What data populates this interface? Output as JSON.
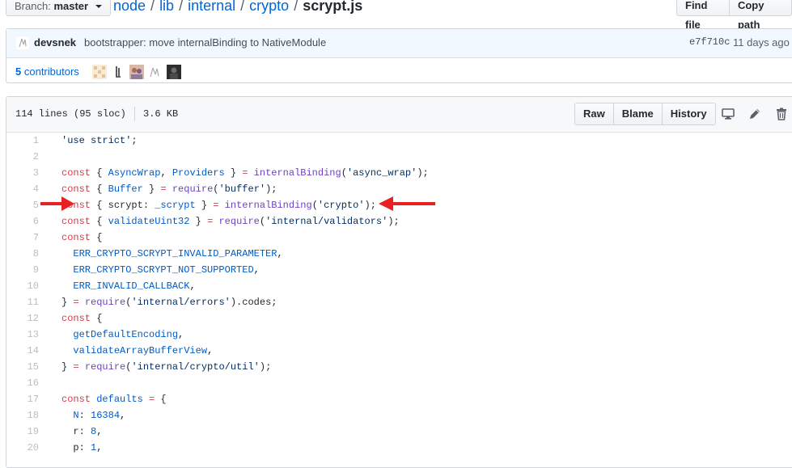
{
  "branch": {
    "label": "Branch:",
    "value": "master"
  },
  "breadcrumb": {
    "parts": [
      "node",
      "lib",
      "internal",
      "crypto"
    ],
    "separator": "/",
    "file": "scrypt.js"
  },
  "top_buttons": {
    "find_file": "Find file",
    "copy_path": "Copy path"
  },
  "commit": {
    "author": "devsnek",
    "message": "bootstrapper: move internalBinding to NativeModule",
    "sha": "e7f710c",
    "date": "11 days ago"
  },
  "contributors": {
    "count": "5",
    "label": "contributors"
  },
  "file": {
    "lines_info": "114 lines (95 sloc)",
    "size": "3.6 KB",
    "buttons": {
      "raw": "Raw",
      "blame": "Blame",
      "history": "History"
    },
    "icons": [
      "desktop-icon",
      "pencil-icon",
      "trash-icon"
    ]
  },
  "code_lines": [
    {
      "n": "1",
      "segs": [
        [
          "s",
          "'use strict'"
        ],
        [
          "",
          ";"
        ]
      ]
    },
    {
      "n": "2",
      "segs": []
    },
    {
      "n": "3",
      "segs": [
        [
          "k",
          "const"
        ],
        [
          "",
          " { "
        ],
        [
          "c",
          "AsyncWrap"
        ],
        [
          "",
          ", "
        ],
        [
          "c",
          "Providers"
        ],
        [
          "",
          " } "
        ],
        [
          "k",
          "="
        ],
        [
          "",
          " "
        ],
        [
          "f",
          "internalBinding"
        ],
        [
          "",
          "("
        ],
        [
          "s",
          "'async_wrap'"
        ],
        [
          "",
          ");"
        ]
      ]
    },
    {
      "n": "4",
      "segs": [
        [
          "k",
          "const"
        ],
        [
          "",
          " { "
        ],
        [
          "c",
          "Buffer"
        ],
        [
          "",
          " } "
        ],
        [
          "k",
          "="
        ],
        [
          "",
          " "
        ],
        [
          "f",
          "require"
        ],
        [
          "",
          "("
        ],
        [
          "s",
          "'buffer'"
        ],
        [
          "",
          ");"
        ]
      ]
    },
    {
      "n": "5",
      "segs": [
        [
          "k",
          "const"
        ],
        [
          "",
          " { scrypt: "
        ],
        [
          "c",
          "_scrypt"
        ],
        [
          "",
          " } "
        ],
        [
          "k",
          "="
        ],
        [
          "",
          " "
        ],
        [
          "f",
          "internalBinding"
        ],
        [
          "",
          "("
        ],
        [
          "s",
          "'crypto'"
        ],
        [
          "",
          ");"
        ]
      ]
    },
    {
      "n": "6",
      "segs": [
        [
          "k",
          "const"
        ],
        [
          "",
          " { "
        ],
        [
          "c",
          "validateUint32"
        ],
        [
          "",
          " } "
        ],
        [
          "k",
          "="
        ],
        [
          "",
          " "
        ],
        [
          "f",
          "require"
        ],
        [
          "",
          "("
        ],
        [
          "s",
          "'internal/validators'"
        ],
        [
          "",
          ");"
        ]
      ]
    },
    {
      "n": "7",
      "segs": [
        [
          "k",
          "const"
        ],
        [
          "",
          " {"
        ]
      ]
    },
    {
      "n": "8",
      "segs": [
        [
          "",
          "  "
        ],
        [
          "c",
          "ERR_CRYPTO_SCRYPT_INVALID_PARAMETER"
        ],
        [
          "",
          ","
        ]
      ]
    },
    {
      "n": "9",
      "segs": [
        [
          "",
          "  "
        ],
        [
          "c",
          "ERR_CRYPTO_SCRYPT_NOT_SUPPORTED"
        ],
        [
          "",
          ","
        ]
      ]
    },
    {
      "n": "10",
      "segs": [
        [
          "",
          "  "
        ],
        [
          "c",
          "ERR_INVALID_CALLBACK"
        ],
        [
          "",
          ","
        ]
      ]
    },
    {
      "n": "11",
      "segs": [
        [
          "",
          "} "
        ],
        [
          "k",
          "="
        ],
        [
          "",
          " "
        ],
        [
          "f",
          "require"
        ],
        [
          "",
          "("
        ],
        [
          "s",
          "'internal/errors'"
        ],
        [
          "",
          ").codes;"
        ]
      ]
    },
    {
      "n": "12",
      "segs": [
        [
          "k",
          "const"
        ],
        [
          "",
          " {"
        ]
      ]
    },
    {
      "n": "13",
      "segs": [
        [
          "",
          "  "
        ],
        [
          "c",
          "getDefaultEncoding"
        ],
        [
          "",
          ","
        ]
      ]
    },
    {
      "n": "14",
      "segs": [
        [
          "",
          "  "
        ],
        [
          "c",
          "validateArrayBufferView"
        ],
        [
          "",
          ","
        ]
      ]
    },
    {
      "n": "15",
      "segs": [
        [
          "",
          "} "
        ],
        [
          "k",
          "="
        ],
        [
          "",
          " "
        ],
        [
          "f",
          "require"
        ],
        [
          "",
          "("
        ],
        [
          "s",
          "'internal/crypto/util'"
        ],
        [
          "",
          ");"
        ]
      ]
    },
    {
      "n": "16",
      "segs": []
    },
    {
      "n": "17",
      "segs": [
        [
          "k",
          "const"
        ],
        [
          "",
          " "
        ],
        [
          "c",
          "defaults"
        ],
        [
          "",
          " "
        ],
        [
          "k",
          "="
        ],
        [
          "",
          " {"
        ]
      ]
    },
    {
      "n": "18",
      "segs": [
        [
          "",
          "  "
        ],
        [
          "c",
          "N"
        ],
        [
          "",
          ": "
        ],
        [
          "c",
          "16384"
        ],
        [
          "",
          ","
        ]
      ]
    },
    {
      "n": "19",
      "segs": [
        [
          "",
          "  r: "
        ],
        [
          "c",
          "8"
        ],
        [
          "",
          ","
        ]
      ]
    },
    {
      "n": "20",
      "segs": [
        [
          "",
          "  p: "
        ],
        [
          "c",
          "1"
        ],
        [
          "",
          ","
        ]
      ]
    }
  ]
}
